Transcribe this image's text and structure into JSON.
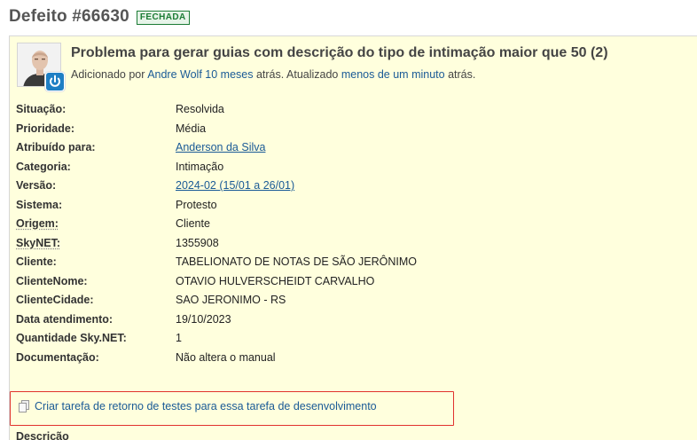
{
  "header": {
    "title": "Defeito #66630",
    "status_badge": "FECHADA"
  },
  "issue": {
    "subject": "Problema para gerar guias com descrição do tipo de intimação maior que 50 (2)",
    "meta": {
      "added_by_prefix": "Adicionado por ",
      "author": "Andre Wolf",
      "added_time": "10 meses",
      "middle_text": " atrás. Atualizado ",
      "updated_time": "menos de um minuto",
      "suffix": " atrás."
    }
  },
  "attributes": [
    {
      "label": "Situação:",
      "value": "Resolvida"
    },
    {
      "label": "Prioridade:",
      "value": "Média"
    },
    {
      "label": "Atribuído para:",
      "value": "Anderson da Silva"
    },
    {
      "label": "Categoria:",
      "value": "Intimação"
    },
    {
      "label": "Versão:",
      "value": "2024-02 (15/01 a 26/01)"
    },
    {
      "label": "Sistema:",
      "value": "Protesto"
    },
    {
      "label": "Origem:",
      "value": "Cliente"
    },
    {
      "label": "SkyNET:",
      "value": "1355908"
    },
    {
      "label": "Cliente:",
      "value": "TABELIONATO DE NOTAS DE SÃO JERÔNIMO"
    },
    {
      "label": "ClienteNome:",
      "value": "OTAVIO HULVERSCHEIDT CARVALHO"
    },
    {
      "label": "ClienteCidade:",
      "value": "SAO JERONIMO - RS"
    },
    {
      "label": "Data atendimento:",
      "value": "19/10/2023"
    },
    {
      "label": "Quantidade Sky.NET:",
      "value": "1"
    },
    {
      "label": "Documentação:",
      "value": "Não altera o manual"
    }
  ],
  "actions": {
    "create_return_task": "Criar tarefa de retorno de testes para essa tarefa de desenvolvimento"
  },
  "description_section": {
    "title": "Descrição"
  },
  "colors": {
    "link": "#1a5a96",
    "box_bg": "#ffffdd",
    "highlight": "#e0322d",
    "badge": "#1c7c35"
  },
  "icons": {
    "avatar_badge": "power-icon",
    "action": "copy-icon"
  }
}
